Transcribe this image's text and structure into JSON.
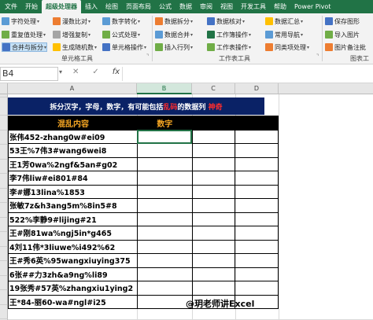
{
  "tabs": [
    "文件",
    "开始",
    "超级处理器",
    "插入",
    "绘图",
    "页面布局",
    "公式",
    "数据",
    "审阅",
    "视图",
    "开发工具",
    "帮助",
    "Power Pivot"
  ],
  "active_tab_index": 2,
  "ribbon": {
    "col1": [
      "字符处理",
      "重复值处理",
      "合并与拆分"
    ],
    "col2": [
      "漫数比对",
      "增强复制",
      "生成随机数"
    ],
    "col3": [
      "数字转化",
      "公式处理",
      "单元格操作"
    ],
    "col4": [
      "数据拆分",
      "数据合并",
      "插入行列"
    ],
    "col5": [
      "数据核对",
      "工作簿操作",
      "工作表操作"
    ],
    "col6": [
      "数据汇总",
      "常用导航",
      "同类项处理"
    ],
    "col7": [
      "保存图形",
      "导入图片",
      "图片备注批"
    ],
    "group_labels": [
      "单元格工具",
      "工作表工具",
      "图表工"
    ]
  },
  "formula_bar": {
    "name_box": "B4",
    "cancel": "✕",
    "enter": "✓",
    "fx": "fx",
    "value": ""
  },
  "columns": [
    "A",
    "B",
    "C",
    "D"
  ],
  "selected_column": "B",
  "banner": {
    "prefix": "拆分汉字，字母，数字，有可能包括",
    "highlight": "乱码",
    "middle": "的数据列",
    "suffix": "神奇"
  },
  "table": {
    "headers": [
      "混乱内容",
      "数字"
    ],
    "rows": [
      "张伟452-zhang0w#ei09",
      "53王%7伟3#wang6wei8",
      "王1芳0wa%2ngf&5an#g02",
      "李7伟liw#ei801#84",
      "李#娜13lina%1853",
      "张敏7z&h3ang5m%8in5#8",
      "522%李静9#lijing#21",
      "王#刚81wa%ngj5in*g465",
      "4刘11伟*3liuwe%i492%62",
      "王#秀6英%95wangxiuying375",
      "6张##力3zh&a9ng%li89",
      "19张秀#57英%zhangxiu1ying2",
      "王*84-丽60-wa#ngl#i25"
    ]
  },
  "watermark": "@玥老师讲Excel"
}
